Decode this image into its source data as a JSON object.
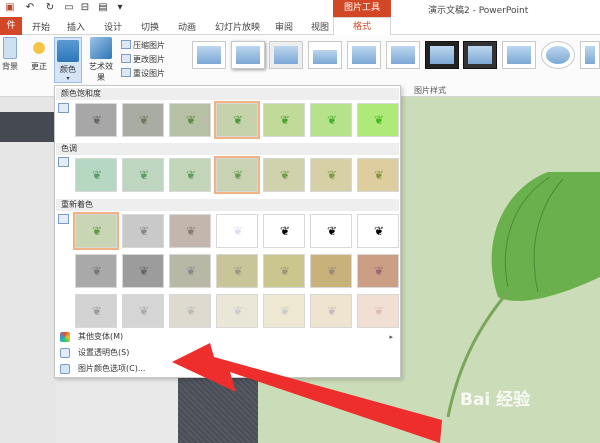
{
  "title_bar": {
    "context_tool_title": "图片工具",
    "document_title": "演示文稿2 - PowerPoint",
    "quick_access": [
      "save-icon",
      "undo-icon",
      "redo-icon",
      "start-icon",
      "screen-icon",
      "open-icon",
      "customize-icon"
    ]
  },
  "tabs": {
    "file": "件",
    "items": [
      "开始",
      "插入",
      "设计",
      "切换",
      "动画",
      "幻灯片放映",
      "审阅",
      "视图"
    ],
    "format": "格式"
  },
  "ribbon": {
    "remove_bg_label": "背景",
    "corrections_label": "更正",
    "color_label": "颜色",
    "artistic_label": "艺术效果",
    "compress_label": "压缩图片",
    "change_label": "更改图片",
    "reset_label": "重设图片",
    "picture_styles_group": "图片样式"
  },
  "dropdown": {
    "saturation_header": "颜色饱和度",
    "tone_header": "色调",
    "recolor_header": "重新着色",
    "more_variations": "其他变体(M)",
    "set_transparent": "设置透明色(S)",
    "picture_color_options": "图片颜色选项(C)...",
    "saturation_swatches": [
      "#a7a7a7",
      "#a9aca2",
      "#b6c0a5",
      "#c6d2ac",
      "#c1da99",
      "#b7e28c",
      "#aee97a"
    ],
    "tone_swatches": [
      "#b6d8c2",
      "#bed6bf",
      "#c3d5b9",
      "#c9d3b3",
      "#d0d2ad",
      "#d7d0a6",
      "#ddcd9f"
    ],
    "recolor_row1": [
      "#c8d6b6",
      "#c9c9c9",
      "#c3b7ad",
      "#ffffff",
      "#ffffff",
      "#ffffff",
      "#ffffff"
    ],
    "recolor_row2": [
      "#a9a9a9",
      "#9c9c9c",
      "#b7b9a6",
      "#c8c598",
      "#cbc58e",
      "#c9b27a",
      "#cc9e84"
    ],
    "recolor_row3": [
      "#d3d3d3",
      "#d5d5d5",
      "#dedad0",
      "#eae7d8",
      "#eee8d2",
      "#efe4d0",
      "#f2dfd4"
    ]
  },
  "watermark": "Bai 经验"
}
